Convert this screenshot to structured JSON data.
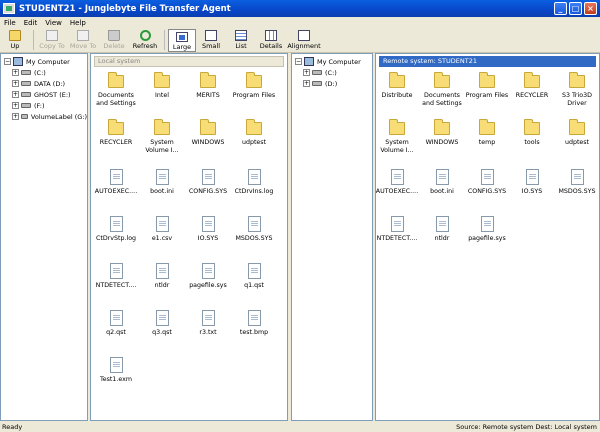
{
  "window": {
    "title": "STUDENT21 - Junglebyte File Transfer Agent"
  },
  "menu": [
    "File",
    "Edit",
    "View",
    "Help"
  ],
  "toolbar": {
    "up": "Up",
    "copy_to": "Copy To",
    "move_to": "Move To",
    "delete": "Delete",
    "refresh": "Refresh",
    "large": "Large",
    "small": "Small",
    "list": "List",
    "details": "Details",
    "alignment": "Alignment"
  },
  "left_tree": {
    "root": "My Computer",
    "drives": [
      "(C:)",
      "DATA (D:)",
      "GHOST (E:)",
      "(F:)",
      "VolumeLabel (G:)"
    ]
  },
  "local": {
    "header": "Local system",
    "items": [
      {
        "name": "Documents\nand Settings",
        "type": "folder"
      },
      {
        "name": "Intel",
        "type": "folder"
      },
      {
        "name": "MERITS",
        "type": "folder"
      },
      {
        "name": "Program Files",
        "type": "folder"
      },
      {
        "name": "RECYCLER",
        "type": "folder"
      },
      {
        "name": "System\nVolume I...",
        "type": "folder"
      },
      {
        "name": "WINDOWS",
        "type": "folder"
      },
      {
        "name": "udptest",
        "type": "folder"
      },
      {
        "name": "AUTOEXEC....",
        "type": "file"
      },
      {
        "name": "boot.ini",
        "type": "file"
      },
      {
        "name": "CONFIG.SYS",
        "type": "file"
      },
      {
        "name": "CtDrvIns.log",
        "type": "file"
      },
      {
        "name": "CtDrvStp.log",
        "type": "file"
      },
      {
        "name": "e1.csv",
        "type": "file"
      },
      {
        "name": "IO.SYS",
        "type": "file"
      },
      {
        "name": "MSDOS.SYS",
        "type": "file"
      },
      {
        "name": "NTDETECT....",
        "type": "file"
      },
      {
        "name": "ntldr",
        "type": "file"
      },
      {
        "name": "pagefile.sys",
        "type": "file"
      },
      {
        "name": "q1.qst",
        "type": "file"
      },
      {
        "name": "q2.qst",
        "type": "file"
      },
      {
        "name": "q3.qst",
        "type": "file"
      },
      {
        "name": "r3.txt",
        "type": "file"
      },
      {
        "name": "test.bmp",
        "type": "file"
      },
      {
        "name": "Test1.exm",
        "type": "file"
      }
    ]
  },
  "remote_tree": {
    "root": "My Computer",
    "drives": [
      "(C:)",
      "(D:)"
    ]
  },
  "remote": {
    "header": "Remote system: STUDENT21",
    "items": [
      {
        "name": "Distribute",
        "type": "folder"
      },
      {
        "name": "Documents\nand Settings",
        "type": "folder"
      },
      {
        "name": "Program Files",
        "type": "folder"
      },
      {
        "name": "RECYCLER",
        "type": "folder"
      },
      {
        "name": "S3 Trio3D\nDriver",
        "type": "folder"
      },
      {
        "name": "System\nVolume I...",
        "type": "folder"
      },
      {
        "name": "WINDOWS",
        "type": "folder"
      },
      {
        "name": "temp",
        "type": "folder"
      },
      {
        "name": "tools",
        "type": "folder"
      },
      {
        "name": "udptest",
        "type": "folder"
      },
      {
        "name": "AUTOEXEC....",
        "type": "file"
      },
      {
        "name": "boot.ini",
        "type": "file"
      },
      {
        "name": "CONFIG.SYS",
        "type": "file"
      },
      {
        "name": "IO.SYS",
        "type": "file"
      },
      {
        "name": "MSDOS.SYS",
        "type": "file"
      },
      {
        "name": "NTDETECT....",
        "type": "file"
      },
      {
        "name": "ntldr",
        "type": "file"
      },
      {
        "name": "pagefile.sys",
        "type": "file"
      }
    ]
  },
  "status": {
    "left": "Ready",
    "right": "Source: Remote system  Dest: Local system"
  }
}
